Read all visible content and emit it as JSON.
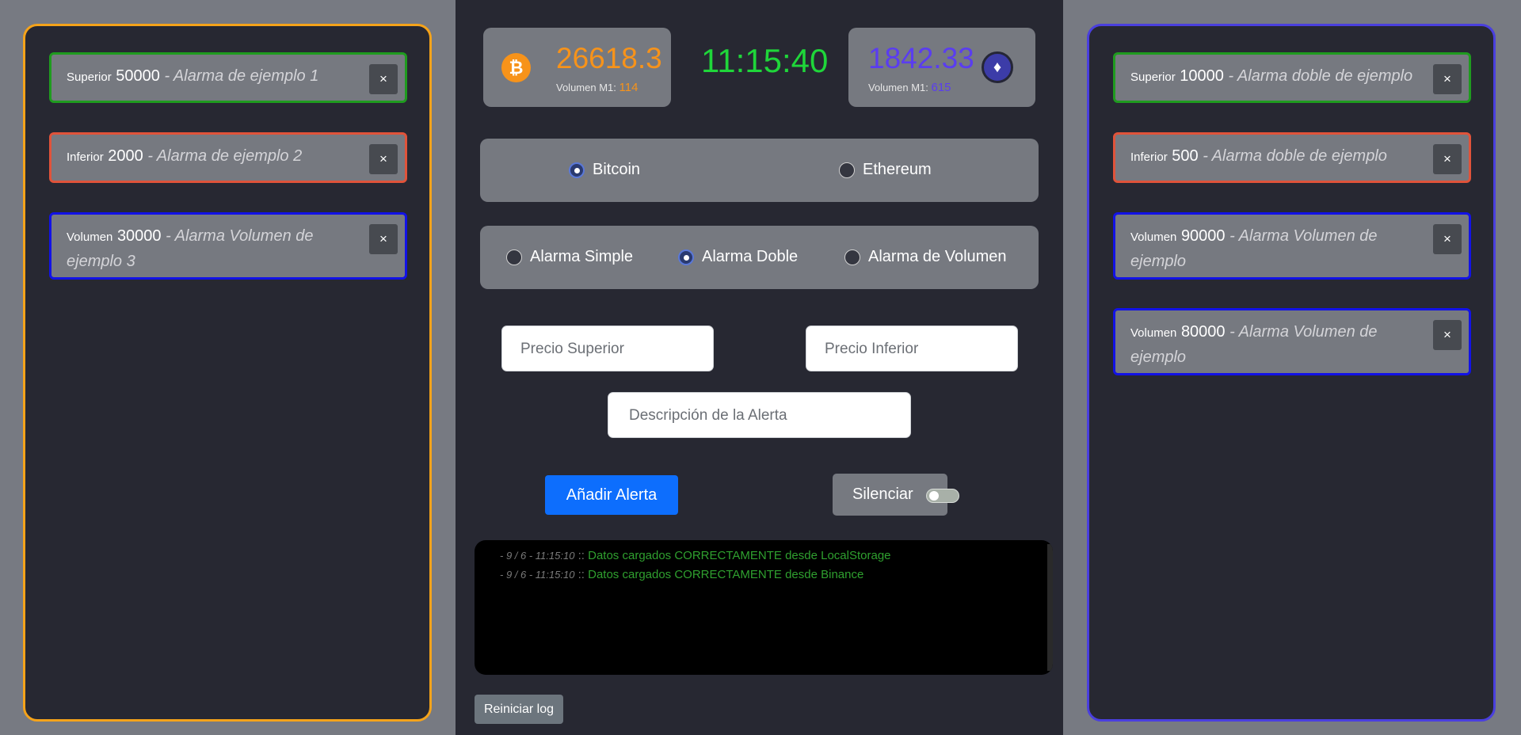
{
  "left_panel": {
    "alarms": [
      {
        "kind": "Superior",
        "value": "50000",
        "desc": "- Alarma de ejemplo 1",
        "close": "×"
      },
      {
        "kind": "Inferior",
        "value": "2000",
        "desc": "- Alarma de ejemplo 2",
        "close": "×"
      },
      {
        "kind": "Volumen",
        "value": "30000",
        "desc": "- Alarma Volumen de ejemplo 3",
        "close": "×"
      }
    ]
  },
  "right_panel": {
    "alarms": [
      {
        "kind": "Superior",
        "value": "10000",
        "desc": "- Alarma doble de ejemplo",
        "close": "×"
      },
      {
        "kind": "Inferior",
        "value": "500",
        "desc": "- Alarma doble de ejemplo",
        "close": "×"
      },
      {
        "kind": "Volumen",
        "value": "90000",
        "desc": "- Alarma Volumen de ejemplo",
        "close": "×"
      },
      {
        "kind": "Volumen",
        "value": "80000",
        "desc": "- Alarma Volumen de ejemplo",
        "close": "×"
      }
    ]
  },
  "ticker": {
    "btc": {
      "icon": "bitcoin-icon",
      "glyph": "₿",
      "price": "26618.3",
      "vol_label": "Volumen M1:",
      "vol_value": "114",
      "color": "#f7931a"
    },
    "eth": {
      "icon": "ethereum-icon",
      "glyph": "♦",
      "price": "1842.33",
      "vol_label": "Volumen M1:",
      "vol_value": "615",
      "color": "#5a3df0"
    },
    "clock": "11:15:40"
  },
  "coin_selector": {
    "options": [
      {
        "label": "Bitcoin",
        "checked": true
      },
      {
        "label": "Ethereum",
        "checked": false
      }
    ]
  },
  "type_selector": {
    "options": [
      {
        "label": "Alarma Simple",
        "checked": false
      },
      {
        "label": "Alarma Doble",
        "checked": true
      },
      {
        "label": "Alarma de Volumen",
        "checked": false
      }
    ]
  },
  "form": {
    "upper_placeholder": "Precio Superior",
    "lower_placeholder": "Precio Inferior",
    "desc_placeholder": "Descripción de la Alerta",
    "add_label": "Añadir Alerta",
    "mute_label": "Silenciar",
    "mute_on": false
  },
  "log": {
    "lines": [
      {
        "ts": "- 9 / 6 - 11:15:10",
        "sep": "::",
        "msg": "Datos cargados CORRECTAMENTE desde LocalStorage"
      },
      {
        "ts": "- 9 / 6 - 11:15:10",
        "sep": "::",
        "msg": "Datos cargados CORRECTAMENTE desde Binance"
      }
    ],
    "reset_label": "Reiniciar log"
  }
}
